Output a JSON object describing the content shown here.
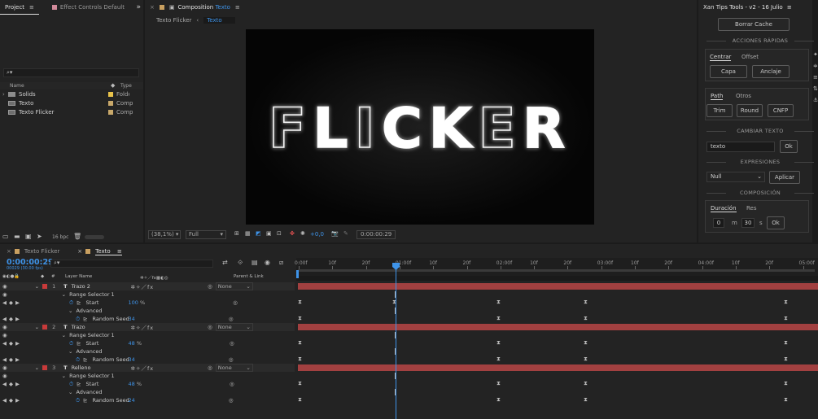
{
  "project": {
    "tab_label": "Project",
    "effect_controls_label": "Effect Controls",
    "effect_controls_value": "Default",
    "search_placeholder": "",
    "col_name": "Name",
    "col_type": "Type",
    "items": [
      {
        "name": "Solids",
        "type": "Folder",
        "color": "#e8c24a"
      },
      {
        "name": "Texto",
        "type": "Comp",
        "color": "#c8a86a"
      },
      {
        "name": "Texto Flicker",
        "type": "Comp",
        "color": "#c8a86a"
      }
    ],
    "bpc": "16 bpc"
  },
  "comp": {
    "tab_prefix": "Composition",
    "tab_name": "Texto",
    "breadcrumb_parent": "Texto Flicker",
    "breadcrumb_current": "Texto",
    "preview_text": "FLICKER",
    "zoom": "(38,1%)",
    "resolution": "Full",
    "exposure": "+0,0",
    "timecode": "0:00:00:29"
  },
  "tools": {
    "title": "Xan Tips Tools - v2 - 16 Julio",
    "borrar_cache": "Borrar Cache",
    "acciones_rapidas": "ACCIONES RÁPIDAS",
    "tab_centrar": "Centrar",
    "tab_offset": "Offset",
    "btn_capa": "Capa",
    "btn_anclaje": "Anclaje",
    "tab_path": "Path",
    "tab_otros": "Otros",
    "btn_trim": "Trim",
    "btn_round": "Round",
    "btn_cnfp": "CNFP",
    "cambiar_texto": "CAMBIAR TEXTO",
    "texto_value": "texto",
    "btn_ok": "Ok",
    "expresiones": "EXPRESIONES",
    "expr_select": "Null",
    "btn_aplicar": "Aplicar",
    "composicion": "COMPOSICIÓN",
    "tab_duracion": "Duración",
    "tab_res": "Res",
    "minutes": "0",
    "m_label": "m",
    "seconds": "30",
    "s_label": "s",
    "btn_ok2": "Ok"
  },
  "timeline": {
    "tab1": "Texto Flicker",
    "tab2": "Texto",
    "timecode": "0:00:00:29",
    "timecode_sub": "00029 (30.00 fps)",
    "col_layer_name": "Layer Name",
    "col_parent": "Parent & Link",
    "ruler": [
      "0:00f",
      "10f",
      "20f",
      "01:00f",
      "10f",
      "20f",
      "02:00f",
      "10f",
      "20f",
      "03:00f",
      "10f",
      "20f",
      "04:00f",
      "10f",
      "20f",
      "05:00f"
    ],
    "layers": [
      {
        "num": "1",
        "name": "Trazo 2",
        "parent": "None",
        "start": "100",
        "seed": "34"
      },
      {
        "num": "2",
        "name": "Trazo",
        "parent": "None",
        "start": "48",
        "seed": "34"
      },
      {
        "num": "3",
        "name": "Relleno",
        "parent": "None",
        "start": "48",
        "seed": "24"
      }
    ],
    "range_selector": "Range Selector 1",
    "start_label": "Start",
    "advanced_label": "Advanced",
    "random_seed_label": "Random Seed",
    "percent": "%"
  }
}
